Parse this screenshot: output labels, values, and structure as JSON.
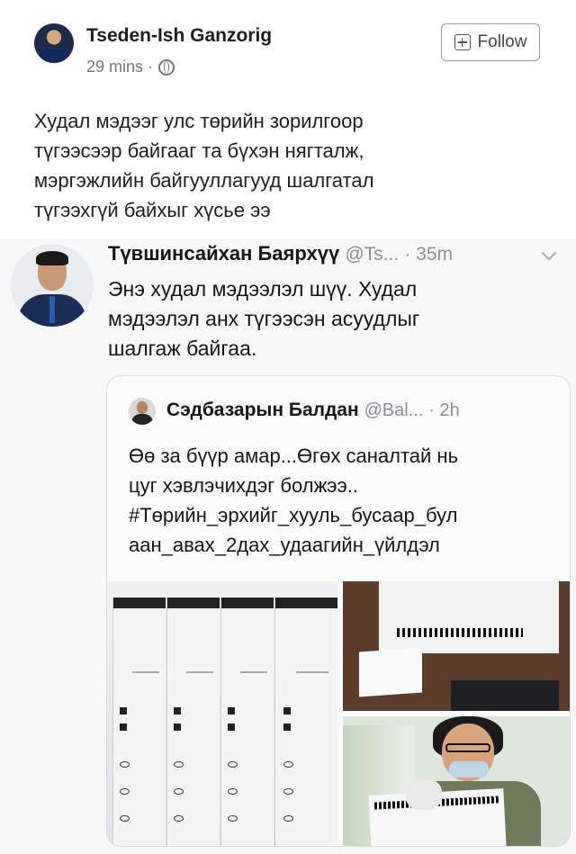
{
  "facebook_post": {
    "author_name": "Tseden-Ish Ganzorig",
    "time": "29 mins ·",
    "follow_label": "Follow",
    "text": "Худал мэдээг улс төрийн зорилгоор\nтүгээсээр байгааг та бүхэн нягталж,\nмэргэжлийн байгууллагууд шалгатал\nтүгээхгүй байхыг хүсье ээ"
  },
  "tweet": {
    "author_name": "Түвшинсайхан Баярхүү",
    "handle": "@Ts...",
    "time": "· 35m",
    "text": "Энэ худал мэдээлэл шүү. Худал\nмэдээлэл анх түгээсэн асуудлыг\nшалгаж байгаа.",
    "quoted": {
      "author_name": "Сэдбазарын Балдан",
      "handle": "@Bal...",
      "time": "· 2h",
      "text": "Өө за бүүр амар...Өгөх саналтай нь\nцуг хэвлэчихдэг болжээ..\n#Төрийн_эрхийг_хууль_бусаар_бул\nаан_авах_2дах_удаагийн_үйлдэл"
    }
  },
  "icons": {
    "globe": "globe-icon",
    "follow": "follow-plus-icon",
    "caret": "chevron-down-icon"
  },
  "colors": {
    "name_text": "#1c1e21",
    "meta_gray": "#8a8f94",
    "background": "#f8f8f8"
  }
}
